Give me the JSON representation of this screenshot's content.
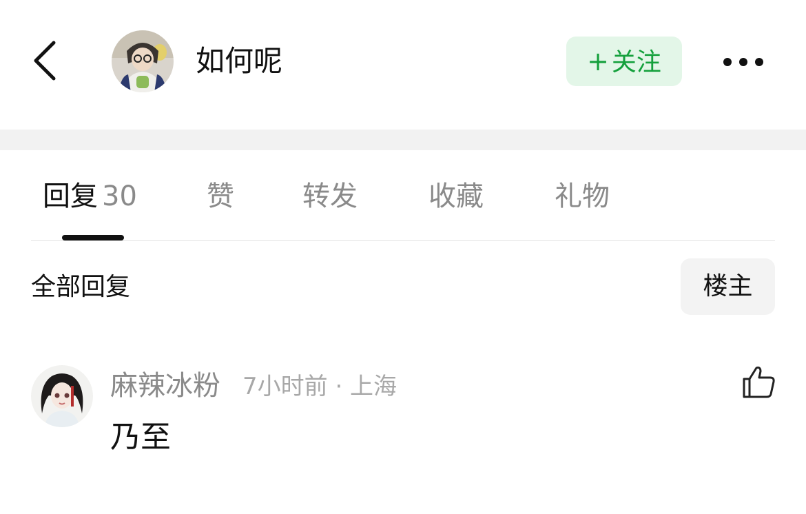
{
  "header": {
    "username": "如何呢",
    "follow_label": "关注",
    "follow_plus": "+",
    "accent": "#14a03c",
    "follow_bg": "#e3f6e8"
  },
  "tabs": [
    {
      "label": "回复",
      "count": "30",
      "active": true
    },
    {
      "label": "赞"
    },
    {
      "label": "转发"
    },
    {
      "label": "收藏"
    },
    {
      "label": "礼物"
    }
  ],
  "section": {
    "title": "全部回复",
    "filter_label": "楼主"
  },
  "comments": [
    {
      "author": "麻辣冰粉",
      "meta": "7小时前 · 上海",
      "text": "乃至"
    }
  ],
  "icons": {
    "back": "back-arrow-icon",
    "more": "more-dots-icon",
    "like": "thumbs-up-icon"
  }
}
